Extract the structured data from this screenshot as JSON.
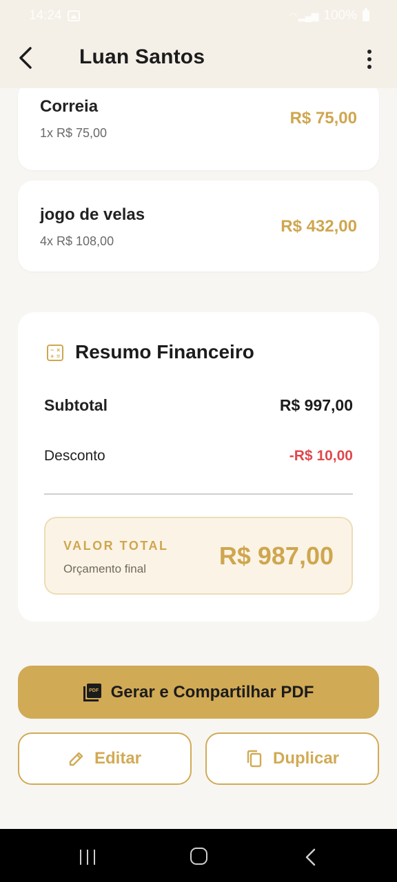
{
  "status_bar": {
    "time": "14:24",
    "battery": "100%"
  },
  "header": {
    "title": "Luan Santos"
  },
  "items": [
    {
      "name": "Correia",
      "qty_price": "1x R$ 75,00",
      "total": "R$ 75,00"
    },
    {
      "name": "jogo de velas",
      "qty_price": "4x R$ 108,00",
      "total": "R$ 432,00"
    }
  ],
  "summary": {
    "title": "Resumo Financeiro",
    "subtotal_label": "Subtotal",
    "subtotal_value": "R$ 997,00",
    "discount_label": "Desconto",
    "discount_value": "-R$ 10,00",
    "total_label": "VALOR TOTAL",
    "total_sub": "Orçamento final",
    "total_value": "R$ 987,00"
  },
  "actions": {
    "pdf_label": "Gerar e Compartilhar PDF",
    "pdf_icon_text": "PDF",
    "edit_label": "Editar",
    "duplicate_label": "Duplicar"
  },
  "colors": {
    "accent": "#d1aa55",
    "discount": "#e0474c"
  }
}
